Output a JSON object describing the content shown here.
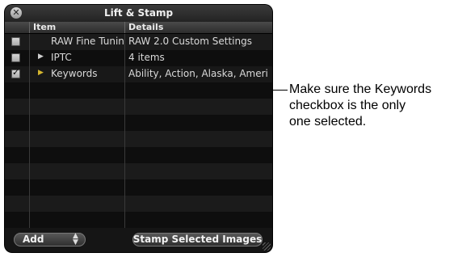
{
  "window": {
    "title": "Lift & Stamp"
  },
  "columns": {
    "item": "Item",
    "details": "Details"
  },
  "rows": [
    {
      "checked": false,
      "disclosure": false,
      "item": "RAW Fine Tunin",
      "details": "RAW 2.0 Custom Settings"
    },
    {
      "checked": false,
      "disclosure": true,
      "item": "IPTC",
      "details": "4 items"
    },
    {
      "checked": true,
      "disclosure": true,
      "item": "Keywords",
      "details": "Ability, Action, Alaska, Ameri"
    }
  ],
  "footer": {
    "add_label": "Add",
    "stamp_label": "Stamp Selected Images"
  },
  "callout": {
    "line1": "Make sure the Keywords",
    "line2": "checkbox is the only",
    "line3": "one selected."
  },
  "icons": {
    "close": "close-icon",
    "disclosure": "disclosure-triangle-icon",
    "updown": "updown-arrows-icon",
    "grip": "resize-grip-icon"
  }
}
